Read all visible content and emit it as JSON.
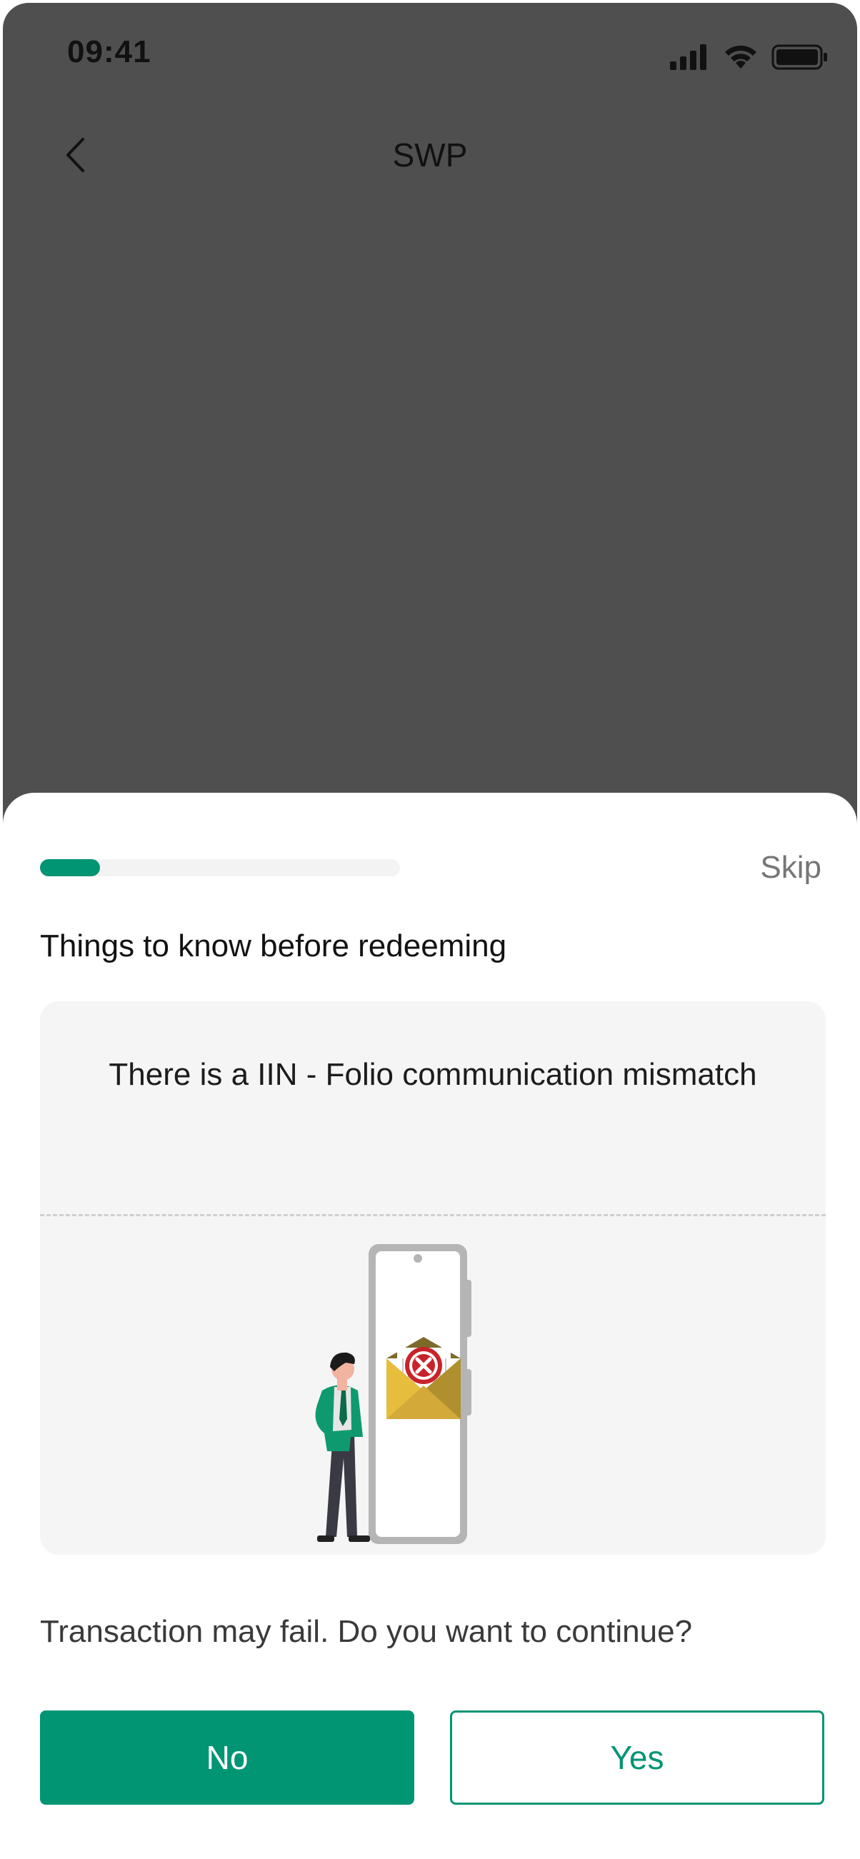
{
  "status_bar": {
    "time": "09:41"
  },
  "header": {
    "title": "SWP"
  },
  "sheet": {
    "progress_fraction": 0.167,
    "skip_label": "Skip",
    "title": "Things to know before redeeming",
    "card_title": "There is a IIN - Folio communication mismatch",
    "question": "Transaction may fail. Do you want to continue?",
    "no_label": "No",
    "yes_label": "Yes"
  },
  "colors": {
    "accent": "#019574",
    "overlay": "#4f4f4f",
    "card_background": "#f5f5f5"
  }
}
